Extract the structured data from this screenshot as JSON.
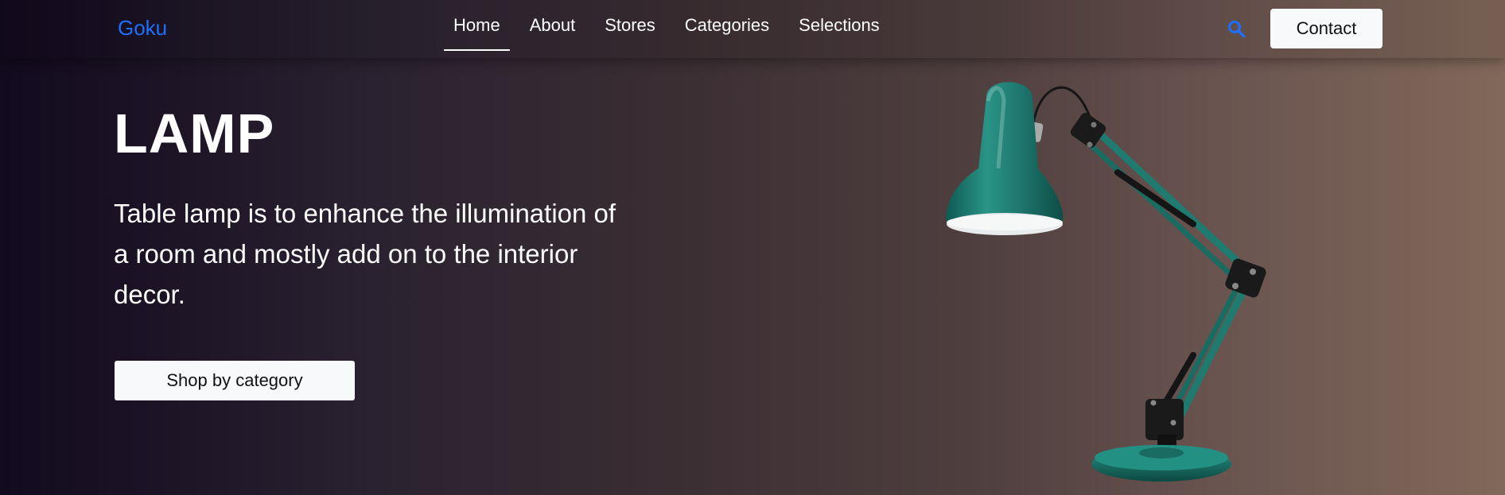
{
  "navbar": {
    "brand": "Goku",
    "links": [
      {
        "label": "Home",
        "active": true
      },
      {
        "label": "About",
        "active": false
      },
      {
        "label": "Stores",
        "active": false
      },
      {
        "label": "Categories",
        "active": false
      },
      {
        "label": "Selections",
        "active": false
      }
    ],
    "search_icon": "search-icon",
    "contact_label": "Contact"
  },
  "hero": {
    "title": "LAMP",
    "description": "Table lamp is to enhance the illumination of a room and mostly add on to the interior decor.",
    "cta_label": "Shop by category",
    "image": "desk-lamp-image"
  },
  "colors": {
    "brand": "#1f6fff",
    "lamp": "#1f7a70",
    "button_bg": "#f8f9fa"
  }
}
